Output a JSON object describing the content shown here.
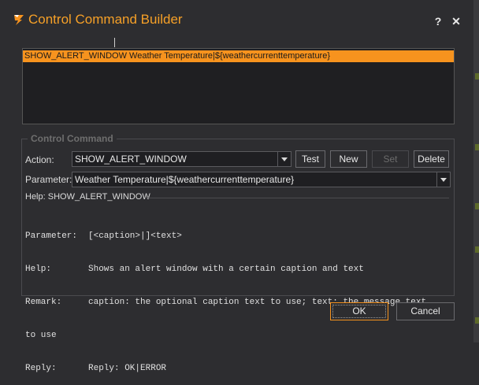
{
  "window": {
    "title": "Control Command Builder",
    "help_glyph": "?",
    "close_glyph": "✕",
    "accent": "#f7931e"
  },
  "command_list": {
    "items": [
      "SHOW_ALERT_WINDOW Weather Temperature|${weathercurrenttemperature}"
    ],
    "selected_index": 0
  },
  "control_command": {
    "legend": "Control Command",
    "action_label": "Action:",
    "action_value": "SHOW_ALERT_WINDOW",
    "parameter_label": "Parameter:",
    "parameter_value": "Weather Temperature|${weathercurrenttemperature}",
    "buttons": {
      "test": "Test",
      "new": "New",
      "set": "Set",
      "delete": "Delete"
    }
  },
  "help": {
    "title": "Help: SHOW_ALERT_WINDOW",
    "rows": [
      {
        "key": "Parameter:",
        "value": "[<caption>|]<text>"
      },
      {
        "key": "Help:",
        "value": "Shows an alert window with a certain caption and text"
      },
      {
        "key": "Remark:",
        "value": "caption: the optional caption text to use; text: the message text"
      },
      {
        "key": "",
        "value": "to use"
      },
      {
        "key": "Reply:",
        "value": "Reply: OK|ERROR"
      }
    ]
  },
  "footer": {
    "ok": "OK",
    "cancel": "Cancel"
  }
}
